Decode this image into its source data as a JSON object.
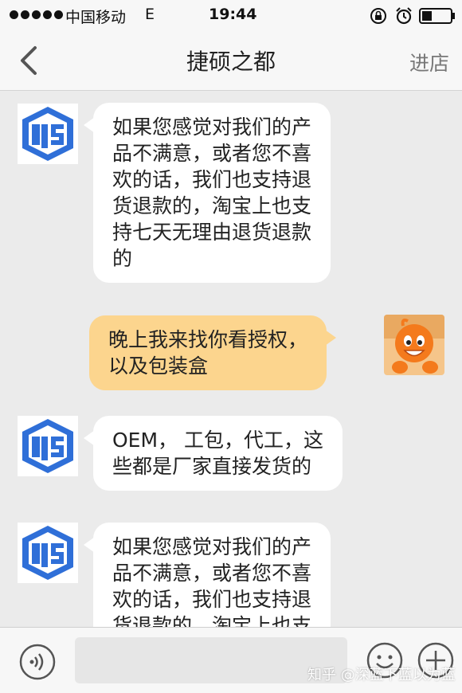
{
  "status_bar": {
    "carrier": "中国移动",
    "network": "E",
    "time": "19:44"
  },
  "nav": {
    "title": "捷硕之都",
    "enter_shop": "进店"
  },
  "shop_logo": "JS",
  "messages": [
    {
      "from": "shop",
      "lines": [
        "如果您感觉对我们的产",
        "品不满意，或者您不喜",
        "欢的话，我们也支持退",
        "货退款的，淘宝上也支",
        "持七天无理由退货退款",
        "的"
      ]
    },
    {
      "from": "me",
      "lines": [
        "晚上我来找你看授权，",
        "以及包装盒"
      ]
    },
    {
      "from": "shop",
      "lines": [
        "OEM， 工包，代工，这",
        "些都是厂家直接发货的"
      ]
    },
    {
      "from": "shop",
      "lines": [
        "如果您感觉对我们的产",
        "品不满意，或者您不喜",
        "欢的话，我们也支持退",
        "货退款的，淘宝上也支"
      ]
    }
  ],
  "input": {
    "value": "",
    "placeholder": ""
  },
  "watermark": "知乎 @深蓝下蓝以为蓝",
  "colors": {
    "background": "#ebebeb",
    "incoming_bubble": "#ffffff",
    "outgoing_bubble": "#fcd58e",
    "logo_blue": "#2f6fd8"
  }
}
